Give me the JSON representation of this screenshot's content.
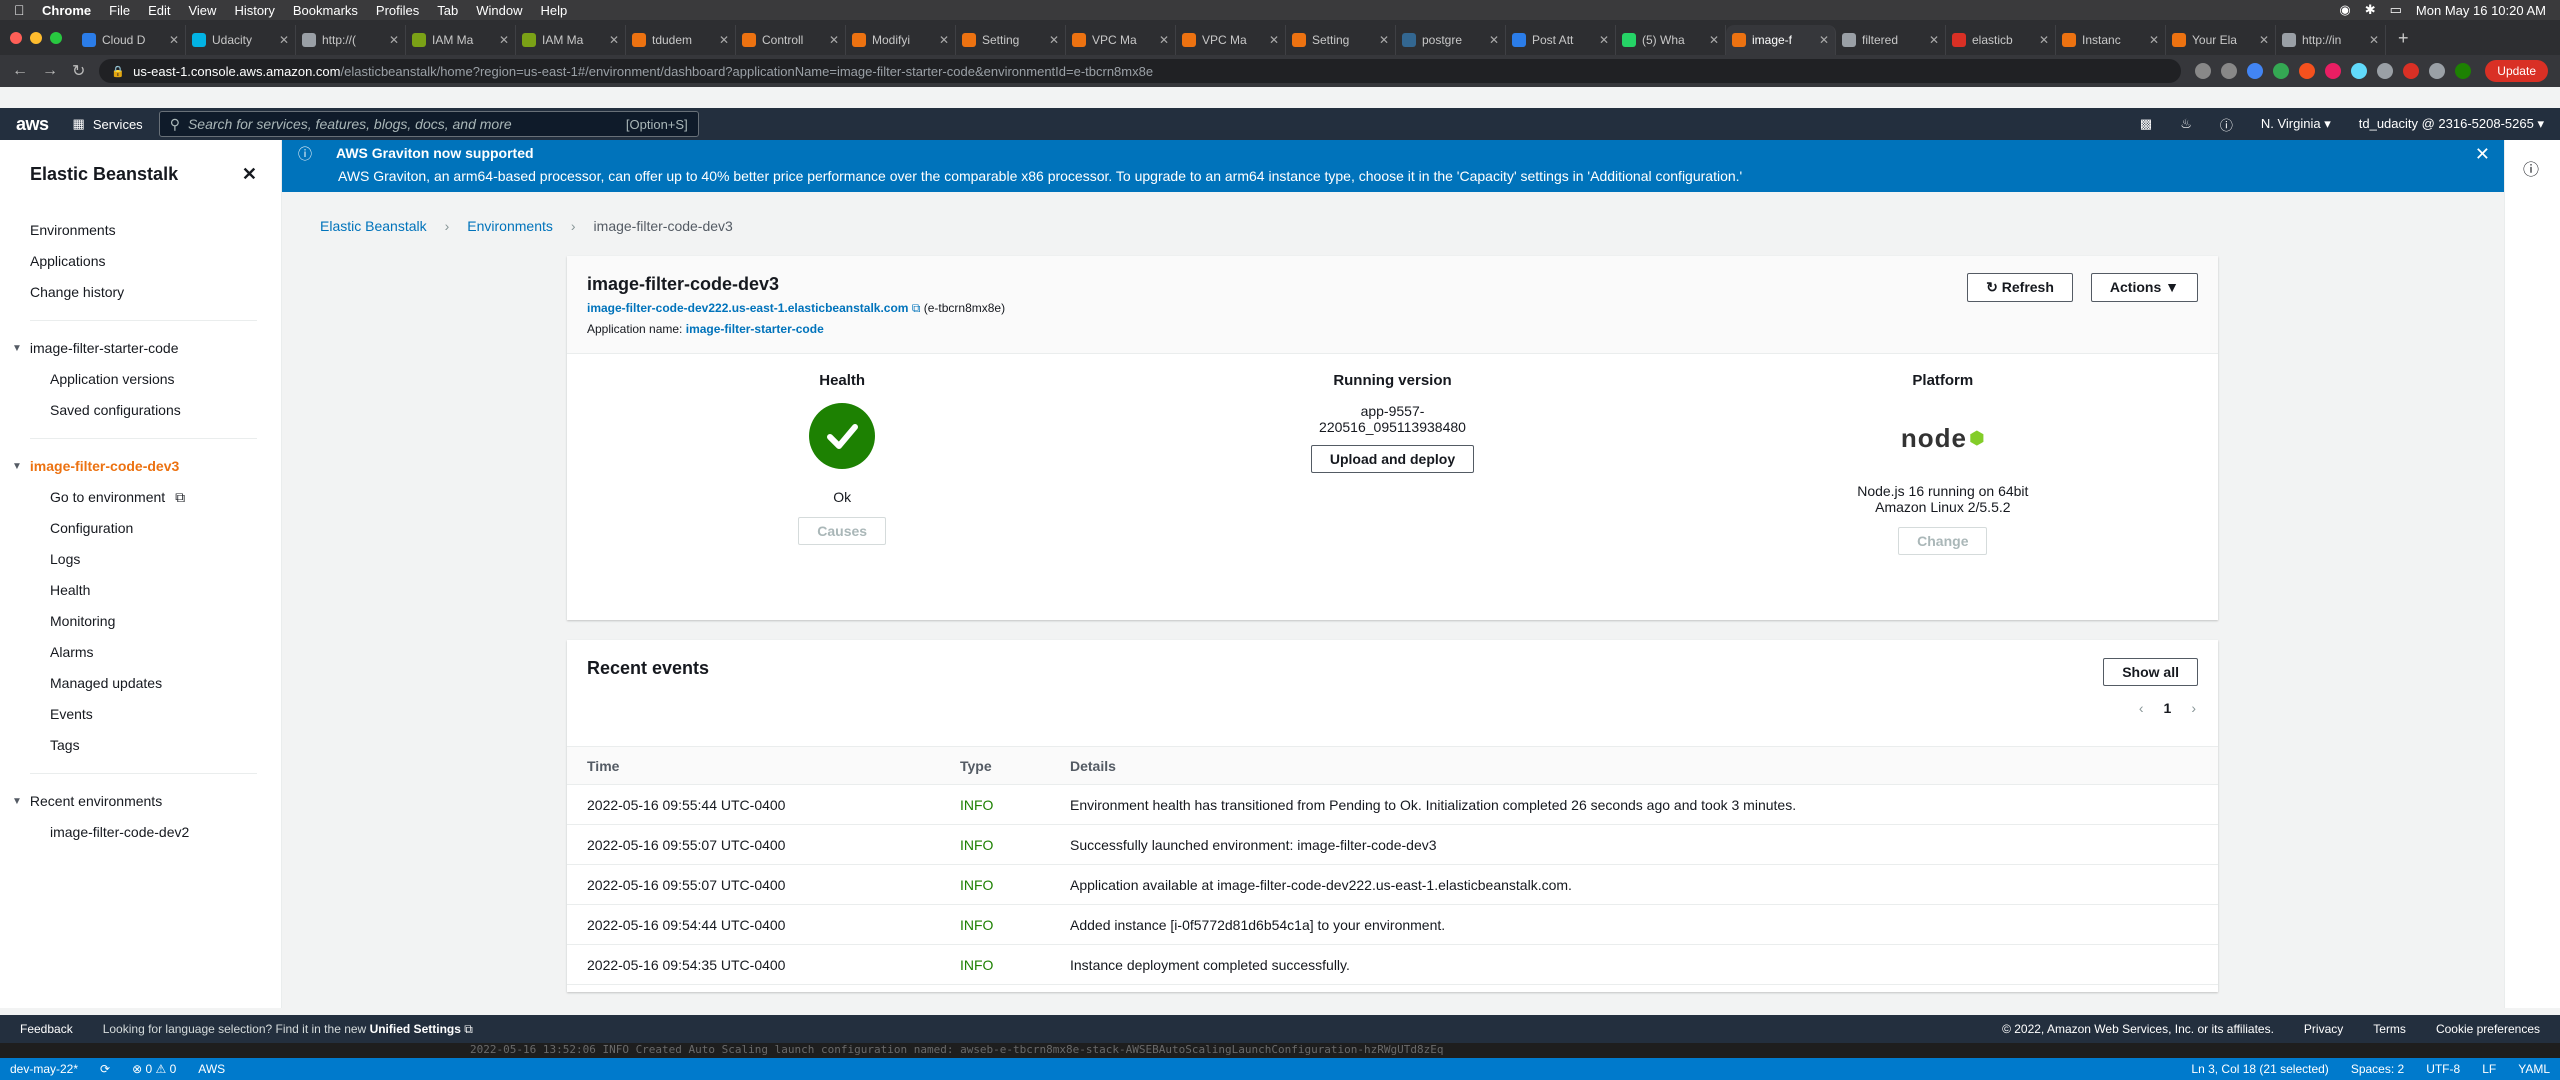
{
  "menubar": {
    "app": "Chrome",
    "items": [
      "File",
      "Edit",
      "View",
      "History",
      "Bookmarks",
      "Profiles",
      "Tab",
      "Window",
      "Help"
    ],
    "clock": "Mon May 16  10:20 AM"
  },
  "tabs": [
    {
      "label": "Cloud D",
      "color": "#2b7de9"
    },
    {
      "label": "Udacity",
      "color": "#02b3e4"
    },
    {
      "label": "http://(",
      "color": "#9aa0a6"
    },
    {
      "label": "IAM Ma",
      "color": "#7aa116"
    },
    {
      "label": "IAM Ma",
      "color": "#7aa116"
    },
    {
      "label": "tdudem",
      "color": "#ec7211"
    },
    {
      "label": "Controll",
      "color": "#ec7211"
    },
    {
      "label": "Modifyi",
      "color": "#ec7211"
    },
    {
      "label": "Setting",
      "color": "#ec7211"
    },
    {
      "label": "VPC Ma",
      "color": "#ec7211"
    },
    {
      "label": "VPC Ma",
      "color": "#ec7211"
    },
    {
      "label": "Setting",
      "color": "#ec7211"
    },
    {
      "label": "postgre",
      "color": "#336791"
    },
    {
      "label": "Post Att",
      "color": "#2b7de9"
    },
    {
      "label": "(5) Wha",
      "color": "#25d366"
    },
    {
      "label": "image-f",
      "color": "#ec7211",
      "active": true
    },
    {
      "label": "filtered",
      "color": "#9aa0a6"
    },
    {
      "label": "elasticb",
      "color": "#d93025"
    },
    {
      "label": "Instanc",
      "color": "#ec7211"
    },
    {
      "label": "Your Ela",
      "color": "#ec7211"
    },
    {
      "label": "http://in",
      "color": "#9aa0a6"
    }
  ],
  "address": {
    "host": "us-east-1.console.aws.amazon.com",
    "path": "/elasticbeanstalk/home?region=us-east-1#/environment/dashboard?applicationName=image-filter-starter-code&environmentId=e-tbcrn8mx8e",
    "update": "Update"
  },
  "awsnav": {
    "logo": "aws",
    "services": "Services",
    "search_placeholder": "Search for services, features, blogs, docs, and more",
    "search_hint": "[Option+S]",
    "region": "N. Virginia ▾",
    "account": "td_udacity @ 2316-5208-5265 ▾"
  },
  "sidebar": {
    "title": "Elastic Beanstalk",
    "top": [
      "Environments",
      "Applications",
      "Change history"
    ],
    "app_group": "image-filter-starter-code",
    "app_items": [
      "Application versions",
      "Saved configurations"
    ],
    "env_group": "image-filter-code-dev3",
    "env_items": [
      "Go to environment",
      "Configuration",
      "Logs",
      "Health",
      "Monitoring",
      "Alarms",
      "Managed updates",
      "Events",
      "Tags"
    ],
    "recent_group": "Recent environments",
    "recent_items": [
      "image-filter-code-dev2"
    ]
  },
  "banner": {
    "title": "AWS Graviton now supported",
    "text": "AWS Graviton, an arm64-based processor, can offer up to 40% better price performance over the comparable x86 processor. To upgrade to an arm64 instance type, choose it in the 'Capacity' settings in 'Additional configuration.'"
  },
  "breadcrumb": [
    "Elastic Beanstalk",
    "Environments",
    "image-filter-code-dev3"
  ],
  "env": {
    "name": "image-filter-code-dev3",
    "url": "image-filter-code-dev222.us-east-1.elasticbeanstalk.com",
    "id": "(e-tbcrn8mx8e)",
    "appname_label": "Application name:",
    "appname": "image-filter-starter-code",
    "refresh": "Refresh",
    "actions": "Actions ▼",
    "health_title": "Health",
    "health_status": "Ok",
    "causes": "Causes",
    "version_title": "Running version",
    "version_line1": "app-9557-",
    "version_line2": "220516_095113938480",
    "upload": "Upload and deploy",
    "platform_title": "Platform",
    "platform_logo": "node",
    "platform_line1": "Node.js 16 running on 64bit",
    "platform_line2": "Amazon Linux 2/5.5.2",
    "change": "Change"
  },
  "events": {
    "title": "Recent events",
    "show_all": "Show all",
    "page": "1",
    "columns": [
      "Time",
      "Type",
      "Details"
    ],
    "rows": [
      [
        "2022-05-16 09:55:44 UTC-0400",
        "INFO",
        "Environment health has transitioned from Pending to Ok. Initialization completed 26 seconds ago and took 3 minutes."
      ],
      [
        "2022-05-16 09:55:07 UTC-0400",
        "INFO",
        "Successfully launched environment: image-filter-code-dev3"
      ],
      [
        "2022-05-16 09:55:07 UTC-0400",
        "INFO",
        "Application available at image-filter-code-dev222.us-east-1.elasticbeanstalk.com."
      ],
      [
        "2022-05-16 09:54:44 UTC-0400",
        "INFO",
        "Added instance [i-0f5772d81d6b54c1a] to your environment."
      ],
      [
        "2022-05-16 09:54:35 UTC-0400",
        "INFO",
        "Instance deployment completed successfully."
      ]
    ]
  },
  "footer": {
    "feedback": "Feedback",
    "lang_prefix": "Looking for language selection? Find it in the new",
    "lang_link": "Unified Settings",
    "copyright": "© 2022, Amazon Web Services, Inc. or its affiliates.",
    "privacy": "Privacy",
    "terms": "Terms",
    "cookie": "Cookie preferences"
  },
  "terminal_line": "2022-05-16 13:52:06    INFO    Created Auto Scaling launch configuration named: awseb-e-tbcrn8mx8e-stack-AWSEBAutoScalingLaunchConfiguration-hzRWgUTd8zEq",
  "vscode": {
    "branch": "dev-may-22*",
    "sync": "⟳",
    "problems": "⊗ 0 ⚠ 0",
    "aws": "AWS",
    "position": "Ln 3, Col 18 (21 selected)",
    "spaces": "Spaces: 2",
    "encoding": "UTF-8",
    "eol": "LF",
    "lang": "YAML"
  }
}
